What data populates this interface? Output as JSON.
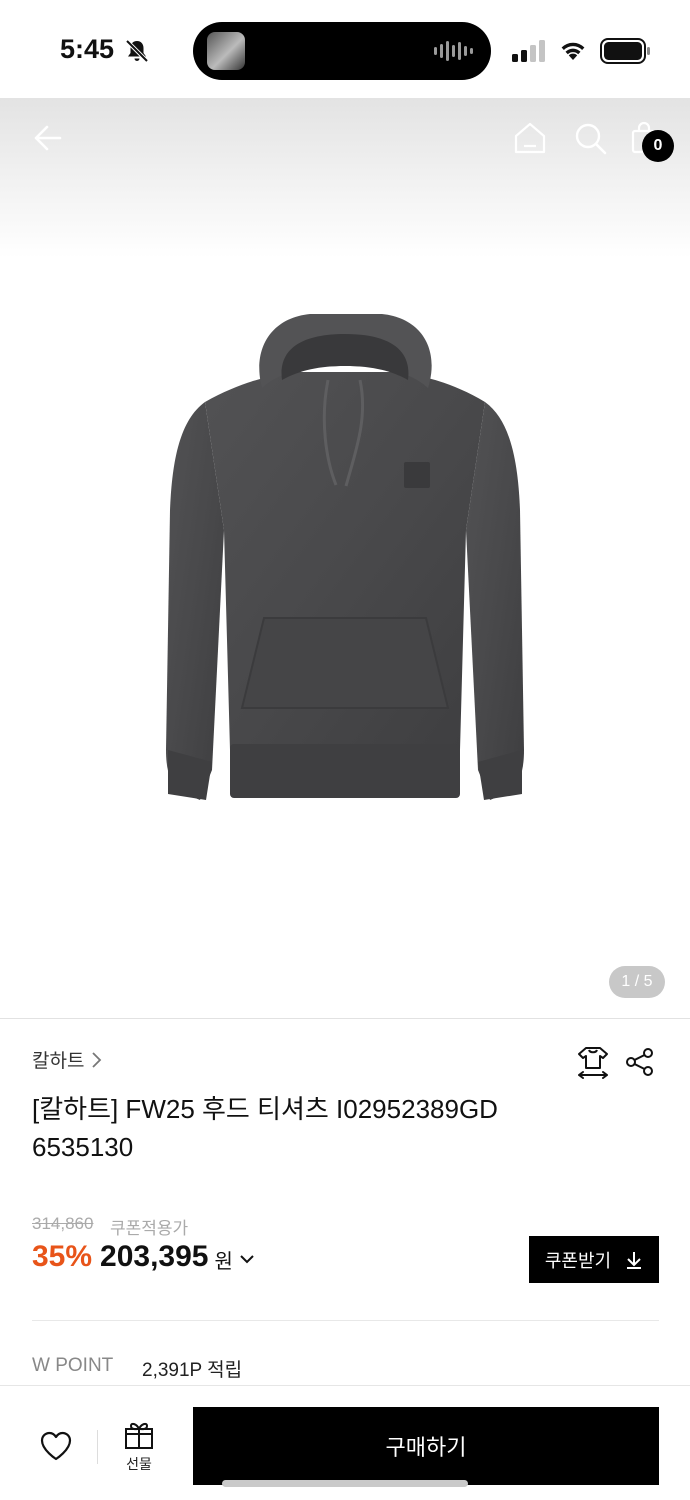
{
  "status_bar": {
    "time": "5:45"
  },
  "header": {
    "cart_count": "0"
  },
  "gallery": {
    "indicator": "1 / 5"
  },
  "product": {
    "brand": "칼하트",
    "title": "[칼하트] FW25 후드 티셔츠 I02952389GD 6535130",
    "original_price": "314,860",
    "coupon_note": "쿠폰적용가",
    "discount_rate": "35%",
    "sale_price": "203,395",
    "currency": "원",
    "coupon_button": "쿠폰받기",
    "wpoint_label": "W POINT",
    "wpoint_value": "2,391P 적립"
  },
  "bottom_bar": {
    "gift_label": "선물",
    "buy_label": "구매하기"
  },
  "colors": {
    "discount": "#e85419",
    "primary": "#000000",
    "hoodie": "#4a4a4c"
  },
  "icons": [
    "bell-slash-icon",
    "signal-icon",
    "wifi-icon",
    "battery-icon",
    "back-arrow-icon",
    "home-icon",
    "search-icon",
    "cart-icon",
    "chevron-right-icon",
    "size-guide-icon",
    "share-icon",
    "chevron-down-icon",
    "download-icon",
    "heart-icon",
    "gift-icon"
  ]
}
